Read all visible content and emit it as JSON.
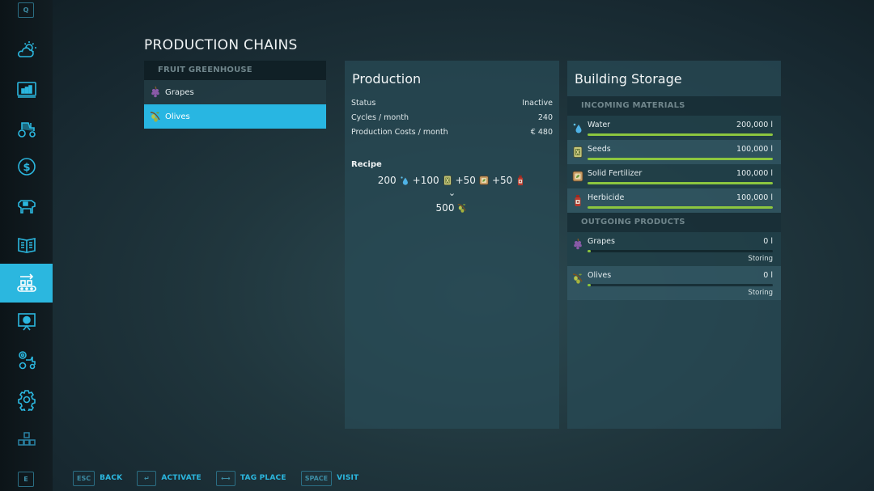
{
  "sidebar": {
    "top_key": "Q",
    "bottom_key": "E",
    "items": [
      {
        "name": "weather",
        "icon": "weather-icon",
        "active": false
      },
      {
        "name": "statistics",
        "icon": "statistics-icon",
        "active": false
      },
      {
        "name": "vehicles",
        "icon": "tractor-icon",
        "active": false
      },
      {
        "name": "finances",
        "icon": "dollar-icon",
        "active": false
      },
      {
        "name": "animals",
        "icon": "cow-icon",
        "active": false
      },
      {
        "name": "contracts",
        "icon": "contracts-icon",
        "active": false
      },
      {
        "name": "production",
        "icon": "production-chain-icon",
        "active": true
      },
      {
        "name": "help",
        "icon": "presentation-icon",
        "active": false
      },
      {
        "name": "game-settings",
        "icon": "tractor-gear-icon",
        "active": false
      },
      {
        "name": "settings",
        "icon": "gear-icon",
        "active": false
      },
      {
        "name": "controls",
        "icon": "blocks-icon",
        "active": false
      }
    ]
  },
  "page": {
    "title": "PRODUCTION CHAINS"
  },
  "chains": {
    "group": "FRUIT GREENHOUSE",
    "items": [
      {
        "label": "Grapes",
        "icon": "grapes-icon",
        "selected": false
      },
      {
        "label": "Olives",
        "icon": "olives-icon",
        "selected": true
      }
    ]
  },
  "production": {
    "title": "Production",
    "rows": [
      {
        "label": "Status",
        "value": "Inactive"
      },
      {
        "label": "Cycles / month",
        "value": "240"
      },
      {
        "label": "Production Costs / month",
        "value": "€ 480"
      }
    ],
    "recipe_label": "Recipe",
    "inputs": [
      {
        "prefix": "200",
        "icon": "water-icon"
      },
      {
        "prefix": "+100",
        "icon": "seeds-icon"
      },
      {
        "prefix": "+50",
        "icon": "fertilizer-icon"
      },
      {
        "prefix": "+50",
        "icon": "herbicide-icon"
      }
    ],
    "arrow": "⌄",
    "output": {
      "amount": "500",
      "icon": "olives-icon"
    }
  },
  "storage": {
    "title": "Building Storage",
    "incoming_header": "INCOMING MATERIALS",
    "incoming": [
      {
        "name": "Water",
        "value": "200,000 l",
        "fill": 1.0,
        "icon": "water-icon"
      },
      {
        "name": "Seeds",
        "value": "100,000 l",
        "fill": 1.0,
        "icon": "seeds-icon"
      },
      {
        "name": "Solid Fertilizer",
        "value": "100,000 l",
        "fill": 1.0,
        "icon": "fertilizer-icon"
      },
      {
        "name": "Herbicide",
        "value": "100,000 l",
        "fill": 1.0,
        "icon": "herbicide-icon"
      }
    ],
    "outgoing_header": "OUTGOING PRODUCTS",
    "outgoing": [
      {
        "name": "Grapes",
        "value": "0 l",
        "fill": 0.0,
        "status": "Storing",
        "icon": "grapes-icon"
      },
      {
        "name": "Olives",
        "value": "0 l",
        "fill": 0.0,
        "status": "Storing",
        "icon": "olives-icon"
      }
    ]
  },
  "footer": {
    "hints": [
      {
        "key": "ESC",
        "label": "BACK"
      },
      {
        "key": "↵",
        "label": "ACTIVATE"
      },
      {
        "key": "⟷",
        "label": "TAG PLACE"
      },
      {
        "key": "SPACE",
        "label": "VISIT"
      }
    ]
  },
  "colors": {
    "accent": "#2bb7df",
    "bar_fill": "#8cc63f"
  }
}
